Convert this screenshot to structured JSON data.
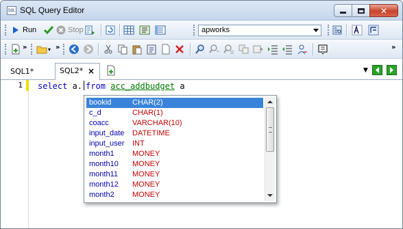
{
  "window": {
    "title": "SQL Query Editor",
    "app_icon_text": "SQL"
  },
  "toolbar1": {
    "run_label": "Run",
    "stop_label": "Stop",
    "database": "apworks"
  },
  "tabs": [
    {
      "label": "SQL1*"
    },
    {
      "label": "SQL2*",
      "close": "×"
    }
  ],
  "editor": {
    "line_number": "1",
    "code": {
      "kw1": "select",
      "t1": " a.",
      "kw2": "from",
      "sp": " ",
      "table": "acc_addbudget",
      "alias": " a"
    }
  },
  "autocomplete": {
    "items": [
      {
        "name": "bookid",
        "type": "CHAR(2)",
        "selected": true
      },
      {
        "name": "c_d",
        "type": "CHAR(1)"
      },
      {
        "name": "coacc",
        "type": "VARCHAR(10)"
      },
      {
        "name": "input_date",
        "type": "DATETIME"
      },
      {
        "name": "input_user",
        "type": "INT"
      },
      {
        "name": "month1",
        "type": "MONEY"
      },
      {
        "name": "month10",
        "type": "MONEY"
      },
      {
        "name": "month11",
        "type": "MONEY"
      },
      {
        "name": "month12",
        "type": "MONEY"
      },
      {
        "name": "month2",
        "type": "MONEY"
      }
    ]
  },
  "colors": {
    "selection": "#3a83da",
    "keyword": "#0000c8",
    "table": "#007a00",
    "type": "#c80000"
  }
}
